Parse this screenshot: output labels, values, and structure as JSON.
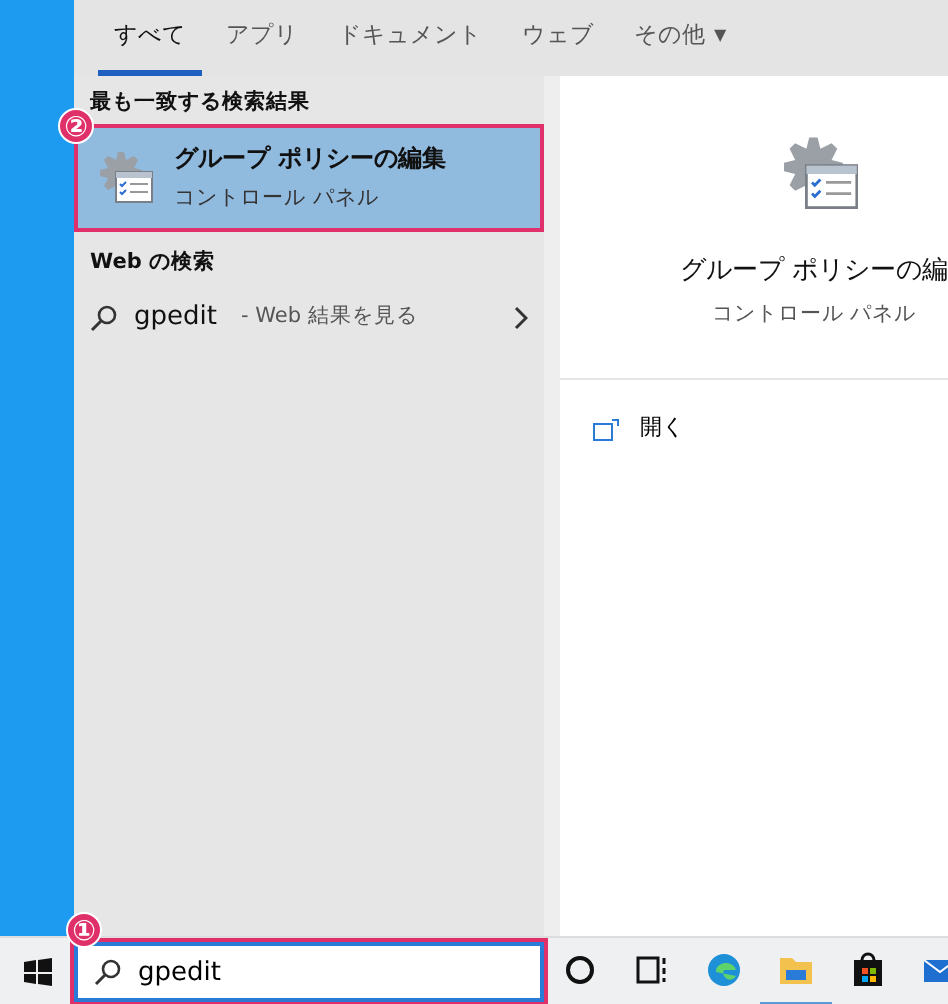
{
  "tabs": [
    {
      "label": "すべて",
      "selected": true
    },
    {
      "label": "アプリ",
      "selected": false
    },
    {
      "label": "ドキュメント",
      "selected": false
    },
    {
      "label": "ウェブ",
      "selected": false
    },
    {
      "label": "その他",
      "selected": false,
      "caret": "▼"
    }
  ],
  "best_match": {
    "heading": "最も一致する検索結果",
    "title": "グループ ポリシーの編集",
    "subtitle": "コントロール パネル",
    "selected": true,
    "marker": "②"
  },
  "web_search": {
    "heading": "Web の検索",
    "query": "gpedit",
    "hint": "- Web 結果を見る"
  },
  "preview": {
    "title": "グループ ポリシーの編",
    "subtitle": "コントロール パネル",
    "actions": [
      {
        "label": "開く"
      }
    ]
  },
  "taskbar": {
    "search": {
      "value": "gpedit",
      "marker": "①"
    },
    "apps": [
      {
        "kind": "cortana",
        "active": false
      },
      {
        "kind": "taskview",
        "active": false
      },
      {
        "kind": "edge",
        "active": false
      },
      {
        "kind": "explorer",
        "active": true
      },
      {
        "kind": "store",
        "active": false
      },
      {
        "kind": "mail",
        "active": false
      }
    ]
  }
}
